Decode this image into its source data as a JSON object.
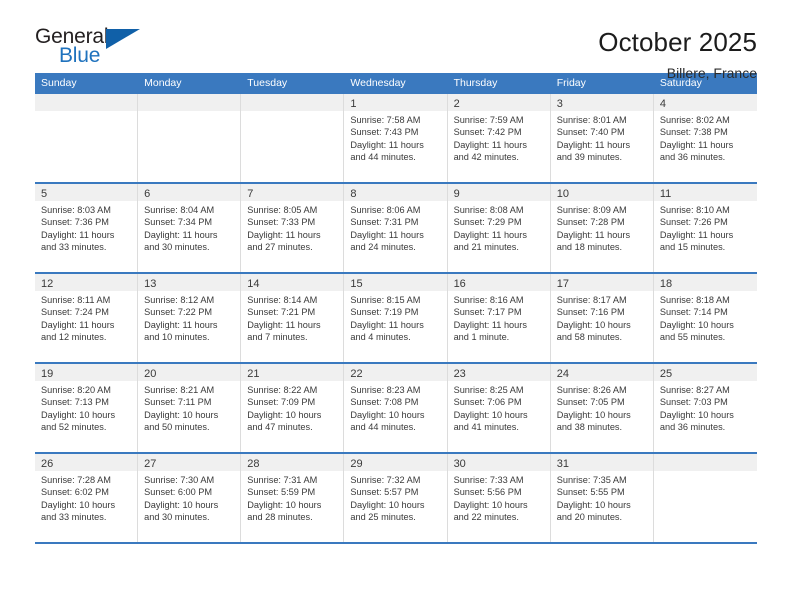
{
  "brand": {
    "name_top": "General",
    "name_bottom": "Blue",
    "accent_color": "#1f72bd",
    "triangle_color": "#1060a8"
  },
  "header": {
    "title": "October 2025",
    "subtitle": "Billere, France"
  },
  "calendar": {
    "header_bg": "#3a79bf",
    "daynum_band_bg": "#f0f0f0",
    "weekdays": [
      "Sunday",
      "Monday",
      "Tuesday",
      "Wednesday",
      "Thursday",
      "Friday",
      "Saturday"
    ],
    "weeks": [
      [
        {
          "day": "",
          "sunrise": "",
          "sunset": "",
          "daylight": "",
          "daylight2": ""
        },
        {
          "day": "",
          "sunrise": "",
          "sunset": "",
          "daylight": "",
          "daylight2": ""
        },
        {
          "day": "",
          "sunrise": "",
          "sunset": "",
          "daylight": "",
          "daylight2": ""
        },
        {
          "day": "1",
          "sunrise": "Sunrise: 7:58 AM",
          "sunset": "Sunset: 7:43 PM",
          "daylight": "Daylight: 11 hours",
          "daylight2": "and 44 minutes."
        },
        {
          "day": "2",
          "sunrise": "Sunrise: 7:59 AM",
          "sunset": "Sunset: 7:42 PM",
          "daylight": "Daylight: 11 hours",
          "daylight2": "and 42 minutes."
        },
        {
          "day": "3",
          "sunrise": "Sunrise: 8:01 AM",
          "sunset": "Sunset: 7:40 PM",
          "daylight": "Daylight: 11 hours",
          "daylight2": "and 39 minutes."
        },
        {
          "day": "4",
          "sunrise": "Sunrise: 8:02 AM",
          "sunset": "Sunset: 7:38 PM",
          "daylight": "Daylight: 11 hours",
          "daylight2": "and 36 minutes."
        }
      ],
      [
        {
          "day": "5",
          "sunrise": "Sunrise: 8:03 AM",
          "sunset": "Sunset: 7:36 PM",
          "daylight": "Daylight: 11 hours",
          "daylight2": "and 33 minutes."
        },
        {
          "day": "6",
          "sunrise": "Sunrise: 8:04 AM",
          "sunset": "Sunset: 7:34 PM",
          "daylight": "Daylight: 11 hours",
          "daylight2": "and 30 minutes."
        },
        {
          "day": "7",
          "sunrise": "Sunrise: 8:05 AM",
          "sunset": "Sunset: 7:33 PM",
          "daylight": "Daylight: 11 hours",
          "daylight2": "and 27 minutes."
        },
        {
          "day": "8",
          "sunrise": "Sunrise: 8:06 AM",
          "sunset": "Sunset: 7:31 PM",
          "daylight": "Daylight: 11 hours",
          "daylight2": "and 24 minutes."
        },
        {
          "day": "9",
          "sunrise": "Sunrise: 8:08 AM",
          "sunset": "Sunset: 7:29 PM",
          "daylight": "Daylight: 11 hours",
          "daylight2": "and 21 minutes."
        },
        {
          "day": "10",
          "sunrise": "Sunrise: 8:09 AM",
          "sunset": "Sunset: 7:28 PM",
          "daylight": "Daylight: 11 hours",
          "daylight2": "and 18 minutes."
        },
        {
          "day": "11",
          "sunrise": "Sunrise: 8:10 AM",
          "sunset": "Sunset: 7:26 PM",
          "daylight": "Daylight: 11 hours",
          "daylight2": "and 15 minutes."
        }
      ],
      [
        {
          "day": "12",
          "sunrise": "Sunrise: 8:11 AM",
          "sunset": "Sunset: 7:24 PM",
          "daylight": "Daylight: 11 hours",
          "daylight2": "and 12 minutes."
        },
        {
          "day": "13",
          "sunrise": "Sunrise: 8:12 AM",
          "sunset": "Sunset: 7:22 PM",
          "daylight": "Daylight: 11 hours",
          "daylight2": "and 10 minutes."
        },
        {
          "day": "14",
          "sunrise": "Sunrise: 8:14 AM",
          "sunset": "Sunset: 7:21 PM",
          "daylight": "Daylight: 11 hours",
          "daylight2": "and 7 minutes."
        },
        {
          "day": "15",
          "sunrise": "Sunrise: 8:15 AM",
          "sunset": "Sunset: 7:19 PM",
          "daylight": "Daylight: 11 hours",
          "daylight2": "and 4 minutes."
        },
        {
          "day": "16",
          "sunrise": "Sunrise: 8:16 AM",
          "sunset": "Sunset: 7:17 PM",
          "daylight": "Daylight: 11 hours",
          "daylight2": "and 1 minute."
        },
        {
          "day": "17",
          "sunrise": "Sunrise: 8:17 AM",
          "sunset": "Sunset: 7:16 PM",
          "daylight": "Daylight: 10 hours",
          "daylight2": "and 58 minutes."
        },
        {
          "day": "18",
          "sunrise": "Sunrise: 8:18 AM",
          "sunset": "Sunset: 7:14 PM",
          "daylight": "Daylight: 10 hours",
          "daylight2": "and 55 minutes."
        }
      ],
      [
        {
          "day": "19",
          "sunrise": "Sunrise: 8:20 AM",
          "sunset": "Sunset: 7:13 PM",
          "daylight": "Daylight: 10 hours",
          "daylight2": "and 52 minutes."
        },
        {
          "day": "20",
          "sunrise": "Sunrise: 8:21 AM",
          "sunset": "Sunset: 7:11 PM",
          "daylight": "Daylight: 10 hours",
          "daylight2": "and 50 minutes."
        },
        {
          "day": "21",
          "sunrise": "Sunrise: 8:22 AM",
          "sunset": "Sunset: 7:09 PM",
          "daylight": "Daylight: 10 hours",
          "daylight2": "and 47 minutes."
        },
        {
          "day": "22",
          "sunrise": "Sunrise: 8:23 AM",
          "sunset": "Sunset: 7:08 PM",
          "daylight": "Daylight: 10 hours",
          "daylight2": "and 44 minutes."
        },
        {
          "day": "23",
          "sunrise": "Sunrise: 8:25 AM",
          "sunset": "Sunset: 7:06 PM",
          "daylight": "Daylight: 10 hours",
          "daylight2": "and 41 minutes."
        },
        {
          "day": "24",
          "sunrise": "Sunrise: 8:26 AM",
          "sunset": "Sunset: 7:05 PM",
          "daylight": "Daylight: 10 hours",
          "daylight2": "and 38 minutes."
        },
        {
          "day": "25",
          "sunrise": "Sunrise: 8:27 AM",
          "sunset": "Sunset: 7:03 PM",
          "daylight": "Daylight: 10 hours",
          "daylight2": "and 36 minutes."
        }
      ],
      [
        {
          "day": "26",
          "sunrise": "Sunrise: 7:28 AM",
          "sunset": "Sunset: 6:02 PM",
          "daylight": "Daylight: 10 hours",
          "daylight2": "and 33 minutes."
        },
        {
          "day": "27",
          "sunrise": "Sunrise: 7:30 AM",
          "sunset": "Sunset: 6:00 PM",
          "daylight": "Daylight: 10 hours",
          "daylight2": "and 30 minutes."
        },
        {
          "day": "28",
          "sunrise": "Sunrise: 7:31 AM",
          "sunset": "Sunset: 5:59 PM",
          "daylight": "Daylight: 10 hours",
          "daylight2": "and 28 minutes."
        },
        {
          "day": "29",
          "sunrise": "Sunrise: 7:32 AM",
          "sunset": "Sunset: 5:57 PM",
          "daylight": "Daylight: 10 hours",
          "daylight2": "and 25 minutes."
        },
        {
          "day": "30",
          "sunrise": "Sunrise: 7:33 AM",
          "sunset": "Sunset: 5:56 PM",
          "daylight": "Daylight: 10 hours",
          "daylight2": "and 22 minutes."
        },
        {
          "day": "31",
          "sunrise": "Sunrise: 7:35 AM",
          "sunset": "Sunset: 5:55 PM",
          "daylight": "Daylight: 10 hours",
          "daylight2": "and 20 minutes."
        },
        {
          "day": "",
          "sunrise": "",
          "sunset": "",
          "daylight": "",
          "daylight2": ""
        }
      ]
    ]
  }
}
